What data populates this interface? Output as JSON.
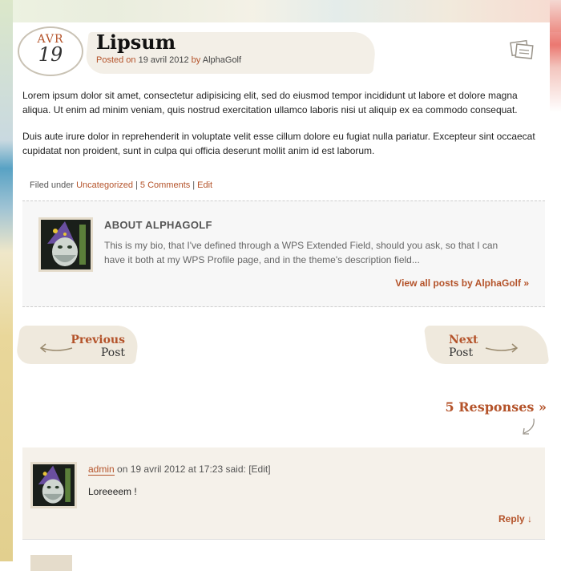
{
  "post": {
    "date_month": "AVR",
    "date_day": "19",
    "title": "Lipsum",
    "posted_on_label": "Posted on",
    "date": "19 avril 2012",
    "by_label": "by",
    "author": "AlphaGolf",
    "paragraphs": [
      "Lorem ipsum dolor sit amet, consectetur adipisicing elit, sed do eiusmod tempor incididunt ut labore et dolore magna aliqua. Ut enim ad minim veniam, quis nostrud exercitation ullamco laboris nisi ut aliquip ex ea commodo consequat.",
      "Duis aute irure dolor in reprehenderit in voluptate velit esse cillum dolore eu fugiat nulla pariatur. Excepteur sint occaecat cupidatat non proident, sunt in culpa qui officia deserunt mollit anim id est laborum."
    ],
    "format_icon": "gallery-icon"
  },
  "footer_meta": {
    "filed_under_label": "Filed under",
    "category": "Uncategorized",
    "comments_link": "5 Comments",
    "edit_link": "Edit"
  },
  "author_box": {
    "title": "ABOUT ALPHAGOLF",
    "bio": "This is my bio, that I've defined through a WPS Extended Field, should you ask, so that I can have it both at my WPS Profile page, and in the theme's description field...",
    "view_all_link": "View all posts by AlphaGolf »"
  },
  "post_nav": {
    "previous_top": "Previous",
    "previous_bottom": "Post",
    "next_top": "Next",
    "next_bottom": "Post"
  },
  "responses": {
    "heading": "5 Responses »"
  },
  "comments": [
    {
      "author": "admin",
      "on_label": "on",
      "datetime": "19 avril 2012 at 17:23",
      "said_label": "said:",
      "edit_label": "[Edit]",
      "text": "Loreeeem !",
      "reply_label": "Reply ↓"
    }
  ],
  "colors": {
    "accent": "#b4532a",
    "panel_bg": "#f7f7f7",
    "comment_bg": "#f5f1ea"
  }
}
